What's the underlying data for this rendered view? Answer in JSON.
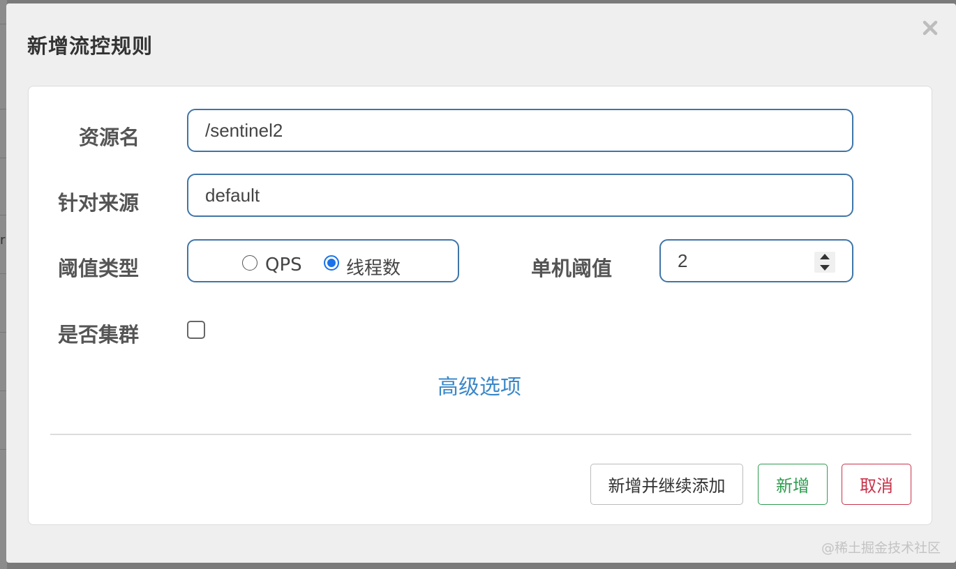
{
  "background": {
    "partial_text": "r"
  },
  "dialog": {
    "title": "新增流控规则",
    "close_icon": "close-icon"
  },
  "form": {
    "resource_name": {
      "label": "资源名",
      "value": "/sentinel2"
    },
    "limit_app": {
      "label": "针对来源",
      "value": "default"
    },
    "threshold_type": {
      "label": "阈值类型",
      "options": [
        {
          "label": "QPS",
          "checked": false
        },
        {
          "label": "线程数",
          "checked": true
        }
      ]
    },
    "single_threshold": {
      "label": "单机阈值",
      "value": "2"
    },
    "cluster": {
      "label": "是否集群",
      "checked": false
    },
    "advanced_link": "高级选项"
  },
  "footer": {
    "add_continue_label": "新增并继续添加",
    "add_label": "新增",
    "cancel_label": "取消"
  },
  "watermark": "@稀土掘金技术社区",
  "colors": {
    "field_border": "#3f75a7",
    "link": "#3b88c8",
    "success": "#2e9c4f",
    "danger": "#c9324a",
    "radio_checked": "#1a73e8"
  }
}
